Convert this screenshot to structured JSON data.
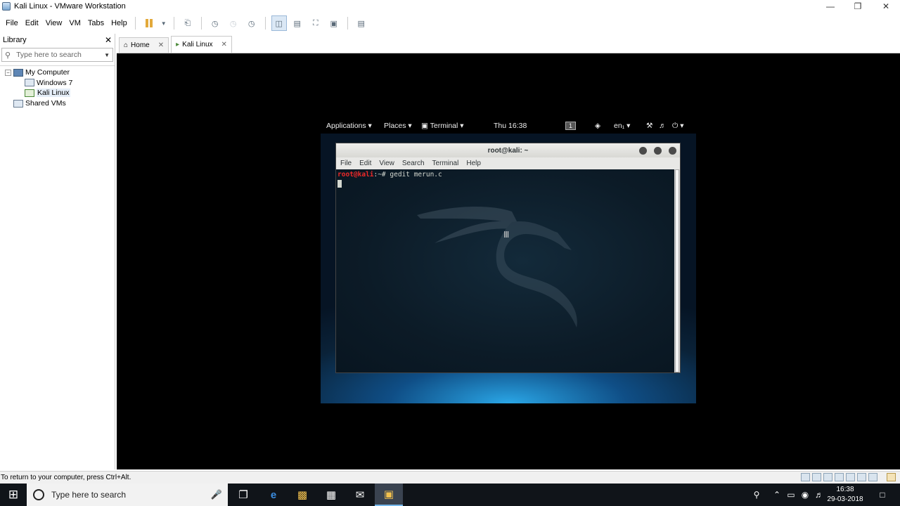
{
  "window": {
    "title": "Kali Linux - VMware Workstation"
  },
  "menu": [
    "File",
    "Edit",
    "View",
    "VM",
    "Tabs",
    "Help"
  ],
  "library": {
    "title": "Library",
    "search_placeholder": "Type here to search",
    "tree": [
      {
        "label": "My Computer",
        "level": 0
      },
      {
        "label": "Windows 7",
        "level": 1
      },
      {
        "label": "Kali Linux",
        "level": 1,
        "selected": true
      },
      {
        "label": "Shared VMs",
        "level": 0
      }
    ]
  },
  "tabs": [
    {
      "label": "Home",
      "active": false
    },
    {
      "label": "Kali Linux",
      "active": true
    }
  ],
  "guest": {
    "topbar": {
      "applications": "Applications",
      "places": "Places",
      "terminal": "Terminal",
      "clock": "Thu 16:38",
      "workspace": "1",
      "lang": "en₁"
    },
    "terminal": {
      "title": "root@kali: ~",
      "menu": [
        "File",
        "Edit",
        "View",
        "Search",
        "Terminal",
        "Help"
      ],
      "prompt": "root@kali",
      "prompt_suffix": ":~# ",
      "command": "gedit merun.c"
    }
  },
  "statusbar": {
    "text": "To return to your computer, press Ctrl+Alt."
  },
  "taskbar": {
    "search_placeholder": "Type here to search",
    "time": "16:38",
    "date": "29-03-2018"
  }
}
